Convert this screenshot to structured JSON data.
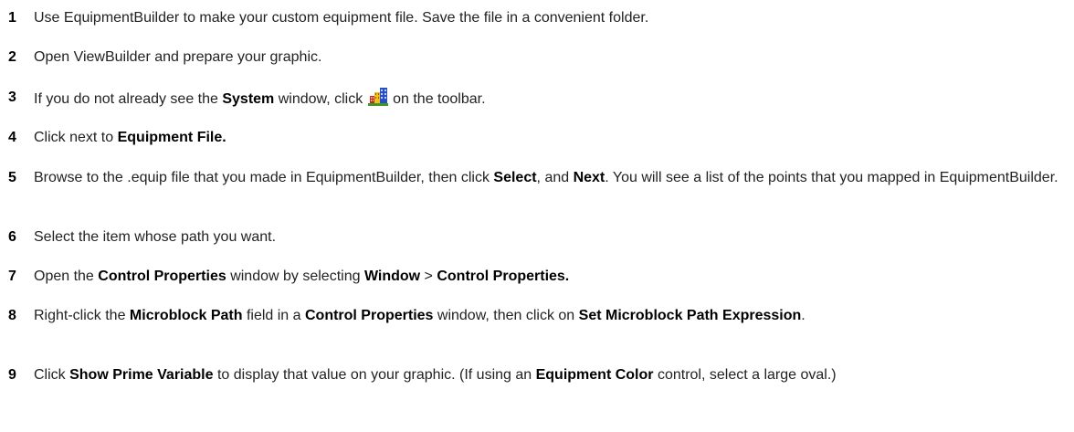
{
  "steps": [
    {
      "number": "1",
      "text": "Use EquipmentBuilder to make your custom equipment file. Save the file in a convenient folder."
    },
    {
      "number": "2",
      "text": "Open ViewBuilder and prepare your graphic."
    },
    {
      "number": "3",
      "t1": "If you do not already see the ",
      "b1": "System",
      "t2": " window, click ",
      "icon": "system-icon",
      "t3": " on the toolbar."
    },
    {
      "number": "4",
      "t1": "Click next to ",
      "b1": "Equipment File."
    },
    {
      "number": "5",
      "t1": "Browse to the .equip file that you made in EquipmentBuilder, then click ",
      "b1": "Select",
      "t2": ", and ",
      "b2": "Next",
      "t3": ". You will see a list of the points that you mapped in EquipmentBuilder."
    },
    {
      "number": "6",
      "text": "Select the item whose path you want."
    },
    {
      "number": "7",
      "t1": "Open the ",
      "b1": "Control Properties",
      "t2": " window by selecting ",
      "b2": "Window",
      "t3": " > ",
      "b3": "Control Properties."
    },
    {
      "number": "8",
      "t1": "Right-click the ",
      "b1": "Microblock Path",
      "t2": " field in a ",
      "b2": "Control Properties",
      "t3": " window, then click on ",
      "b3": "Set Microblock Path Expression",
      "t4": "."
    },
    {
      "number": "9",
      "t1": "Click ",
      "b1": "Show Prime Variable",
      "t2": " to display that value on your graphic. (If using an ",
      "b2": "Equipment Color",
      "t3": " control, select a large oval.)"
    }
  ],
  "colors": {
    "text": "#222222",
    "number": "#000000",
    "icon_building_blue": "#2a4fc4",
    "icon_building_red": "#d02020",
    "icon_building_yellow": "#f0c020",
    "icon_ground_green": "#3a9a2a"
  }
}
